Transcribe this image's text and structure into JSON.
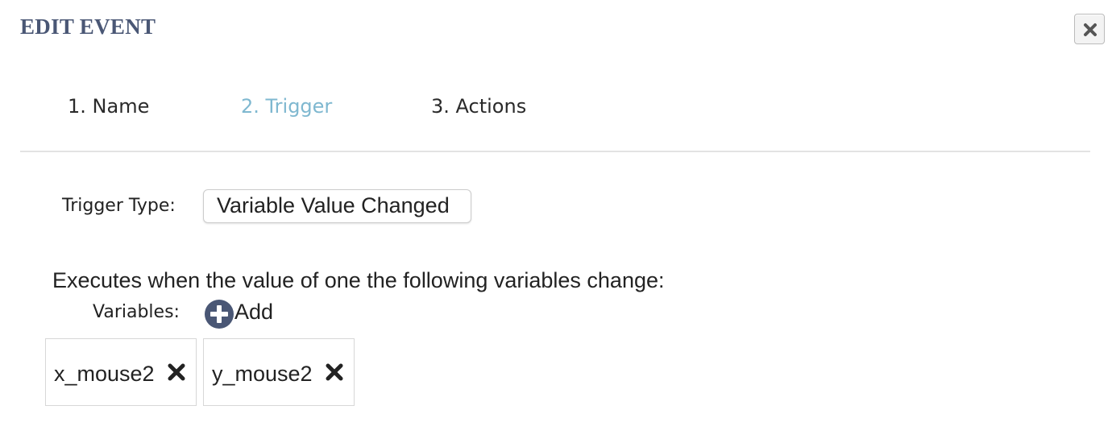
{
  "dialog": {
    "title": "EDIT EVENT",
    "close_icon": "close-x-icon"
  },
  "tabs": [
    {
      "label": "1. Name",
      "active": false
    },
    {
      "label": "2. Trigger",
      "active": true
    },
    {
      "label": "3. Actions",
      "active": false
    }
  ],
  "trigger": {
    "type_label": "Trigger Type:",
    "type_value": "Variable Value Changed"
  },
  "description": "Executes when the value of one the following variables change:",
  "variables": {
    "label": "Variables:",
    "add_label": "Add",
    "add_icon": "plus-circle-icon",
    "items": [
      {
        "name": "x_mouse2",
        "remove_icon": "remove-x-icon"
      },
      {
        "name": "y_mouse2",
        "remove_icon": "remove-x-icon"
      }
    ]
  },
  "colors": {
    "title": "#4a5775",
    "active_tab": "#7fb8d0",
    "add_icon_bg": "#4a5775",
    "divider": "#e3e3e3"
  }
}
